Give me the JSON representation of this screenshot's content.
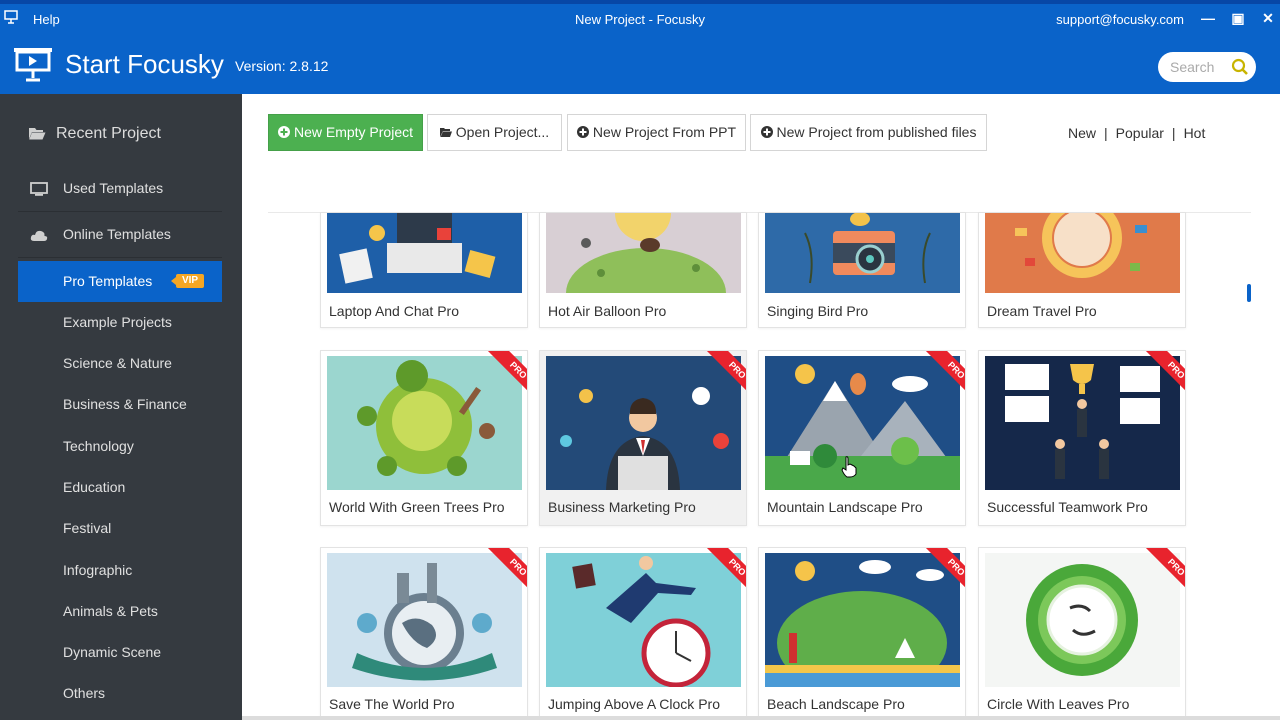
{
  "titlebar": {
    "help": "Help",
    "window_title": "New Project - Focusky",
    "support": "support@focusky.com",
    "minimize": "—",
    "maximize": "▣",
    "close": "✕"
  },
  "header": {
    "brand": "Start Focusky",
    "version": "Version: 2.8.12",
    "search_placeholder": "Search"
  },
  "sidebar": {
    "recent": "Recent Project",
    "used": "Used Templates",
    "online": "Online Templates",
    "categories": [
      {
        "label": "Pro Templates",
        "badge": "VIP"
      },
      {
        "label": "Example Projects"
      },
      {
        "label": "Science & Nature"
      },
      {
        "label": "Business & Finance"
      },
      {
        "label": "Technology"
      },
      {
        "label": "Education"
      },
      {
        "label": "Festival"
      },
      {
        "label": "Infographic"
      },
      {
        "label": "Animals & Pets"
      },
      {
        "label": "Dynamic Scene"
      },
      {
        "label": "Others"
      }
    ]
  },
  "toolbar": {
    "new_empty": "New Empty Project",
    "open": "Open Project...",
    "from_ppt": "New Project From PPT",
    "from_published": "New Project from published files"
  },
  "sort": {
    "new": "New",
    "popular": "Popular",
    "hot": "Hot",
    "sep": "|"
  },
  "pro_badge": "PRO",
  "templates": [
    {
      "name": "Laptop And Chat Pro"
    },
    {
      "name": "Hot Air Balloon Pro"
    },
    {
      "name": "Singing Bird Pro"
    },
    {
      "name": "Dream Travel Pro"
    },
    {
      "name": "World With Green Trees Pro"
    },
    {
      "name": "Business Marketing Pro"
    },
    {
      "name": "Mountain Landscape Pro"
    },
    {
      "name": "Successful Teamwork Pro"
    },
    {
      "name": "Save The World Pro"
    },
    {
      "name": "Jumping Above A Clock Pro"
    },
    {
      "name": "Beach Landscape Pro"
    },
    {
      "name": "Circle With Leaves Pro"
    }
  ]
}
